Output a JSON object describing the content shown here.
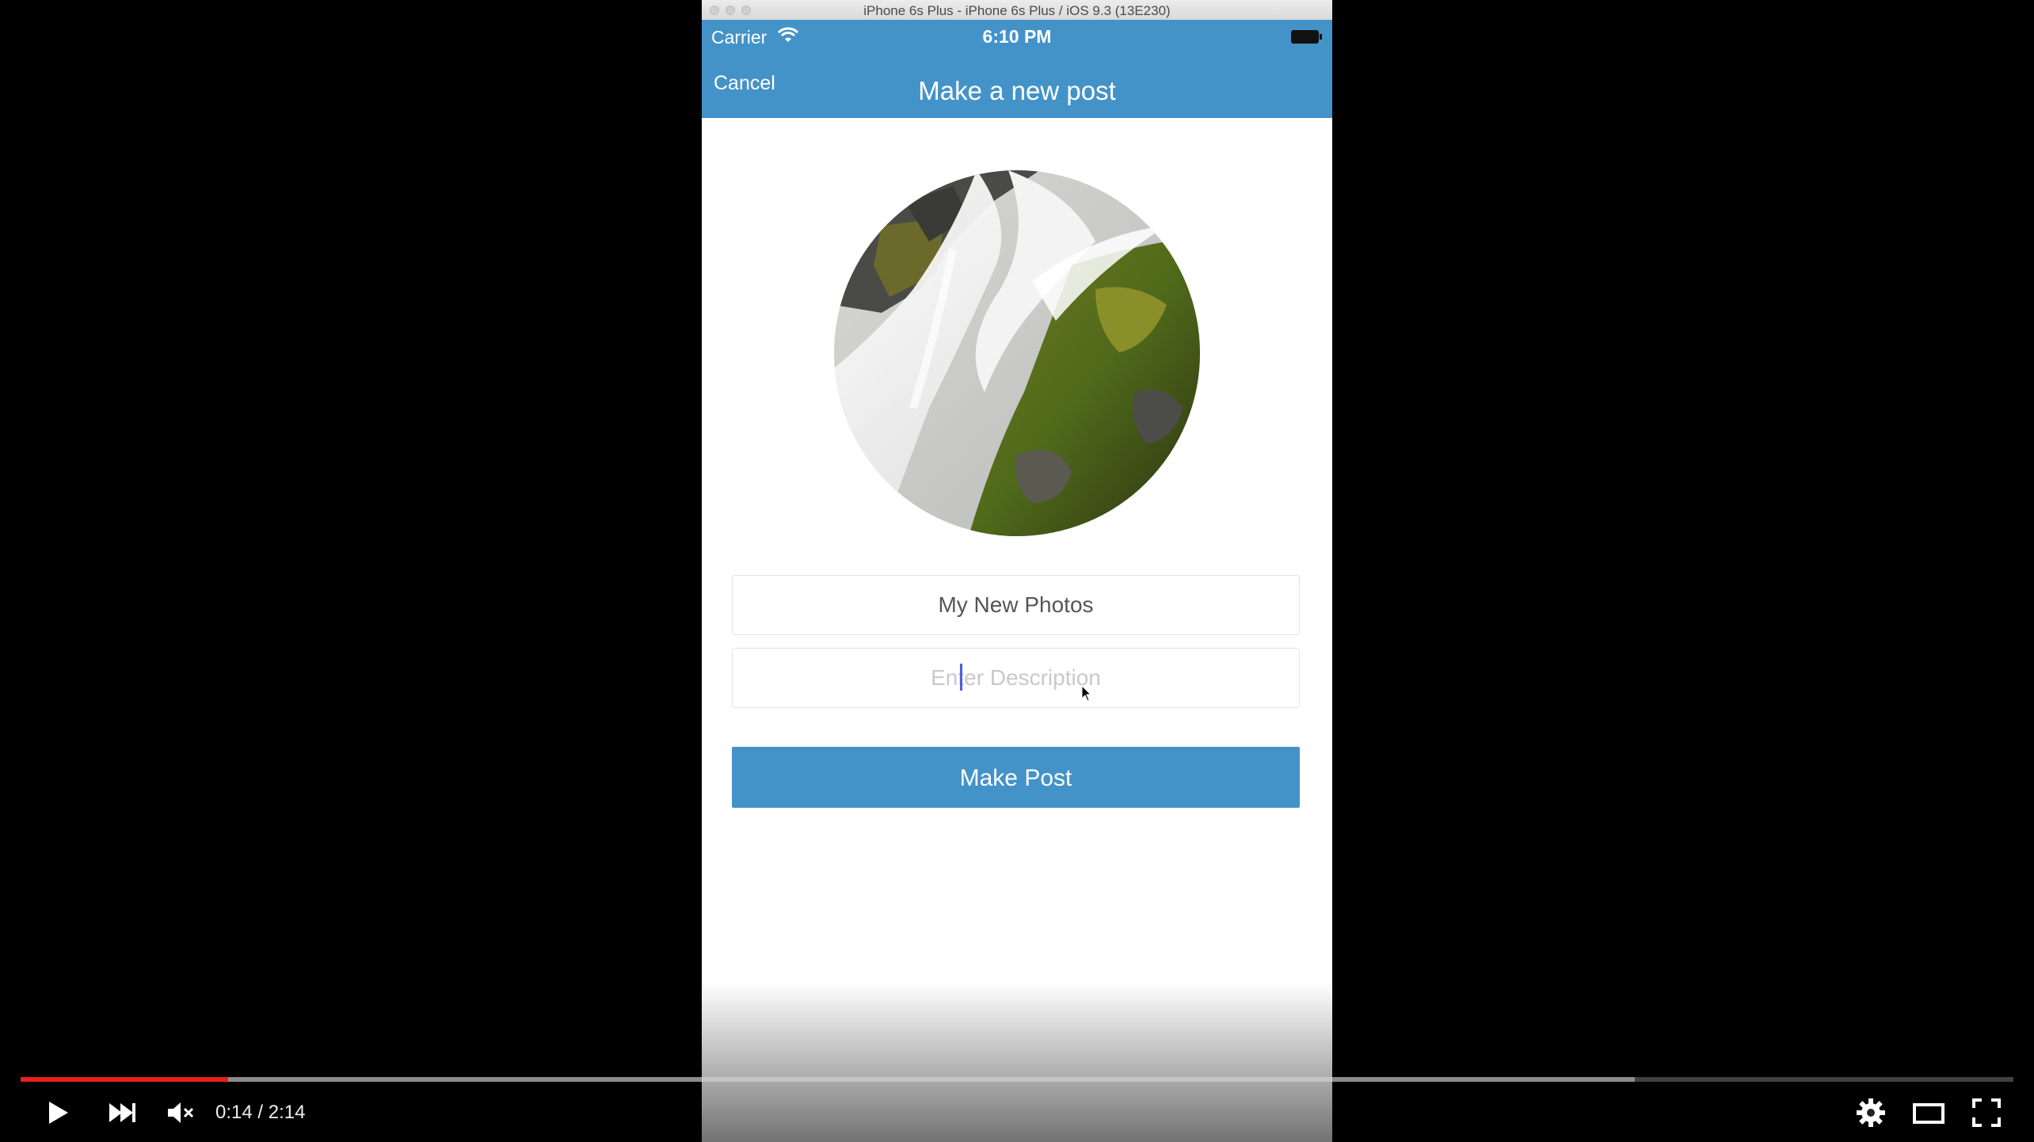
{
  "simulator": {
    "window_title": "iPhone 6s Plus - iPhone 6s Plus / iOS 9.3 (13E230)"
  },
  "status_bar": {
    "carrier": "Carrier",
    "time": "6:10 PM",
    "wifi_icon": "wifi-icon",
    "battery_icon": "battery-icon"
  },
  "nav": {
    "cancel_label": "Cancel",
    "title": "Make a new post",
    "background_color": "#4493c8"
  },
  "form": {
    "title_value": "My New Photos",
    "description_placeholder": "Enter Description",
    "submit_label": "Make Post",
    "photo_subject": "waterfall over mossy rocks"
  },
  "player": {
    "current_time": "0:14",
    "duration": "2:14",
    "time_display": "0:14 / 2:14",
    "played_fraction": 0.104,
    "buffered_fraction": 0.81,
    "progress_color": "#e62117",
    "icons": [
      "play-icon",
      "next-icon",
      "mute-icon",
      "settings-icon",
      "theater-mode-icon",
      "fullscreen-icon"
    ]
  }
}
